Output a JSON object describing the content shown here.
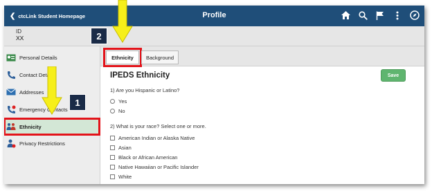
{
  "header": {
    "back_label": "ctcLink Student Homepage",
    "title": "Profile",
    "icons": [
      "home-icon",
      "search-icon",
      "flag-icon",
      "more-vertical-icon",
      "navbar-compass-icon"
    ]
  },
  "id_bar": {
    "label": "ID",
    "value": "XX"
  },
  "sidebar": {
    "items": [
      {
        "label": "Personal Details",
        "icon": "personal-details-icon"
      },
      {
        "label": "Contact Details",
        "icon": "contact-details-icon"
      },
      {
        "label": "Addresses",
        "icon": "envelope-icon"
      },
      {
        "label": "Emergency Contacts",
        "icon": "emergency-contacts-icon"
      },
      {
        "label": "Ethnicity",
        "icon": "ethnicity-icon"
      },
      {
        "label": "Privacy Restrictions",
        "icon": "privacy-restrictions-icon"
      }
    ]
  },
  "tabs": [
    {
      "label": "Ethnicity"
    },
    {
      "label": "Background"
    }
  ],
  "main": {
    "title": "IPEDS Ethnicity",
    "save_label": "Save",
    "q1": "1) Are you Hispanic or Latino?",
    "q1_options": [
      "Yes",
      "No"
    ],
    "q2": "2) What is your race?  Select one or more.",
    "q2_options": [
      "American Indian or Alaska Native",
      "Asian",
      "Black or African American",
      "Native Hawaiian or Pacific Islander",
      "White"
    ]
  },
  "annotations": {
    "step1": "1",
    "step2": "2"
  },
  "colors": {
    "header": "#1f4e79",
    "highlight": "#e3131a",
    "arrow": "#f6ef1a",
    "save": "#5fb56f",
    "selected": "#d3e7d6"
  }
}
